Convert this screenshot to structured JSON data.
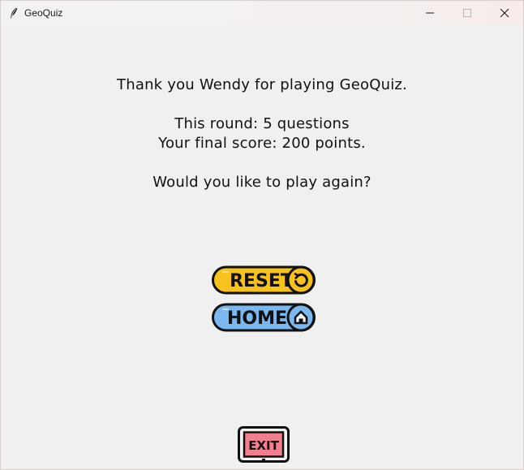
{
  "window": {
    "title": "GeoQuiz",
    "minimize_icon": "minimize-icon",
    "maximize_icon": "maximize-icon",
    "close_icon": "close-icon",
    "app_icon": "feather-icon"
  },
  "message": {
    "thanks": "Thank you Wendy for playing GeoQuiz.",
    "round": "This round: 5 questions",
    "score": "Your final score: 200 points.",
    "prompt": "Would you like to play again?"
  },
  "buttons": {
    "reset": {
      "label": "RESET",
      "icon": "refresh-icon",
      "color": "#f7c21b"
    },
    "home": {
      "label": "HOME",
      "icon": "home-icon",
      "color": "#7ab8ef"
    },
    "exit": {
      "label": "EXIT",
      "color": "#f17f8e"
    }
  }
}
